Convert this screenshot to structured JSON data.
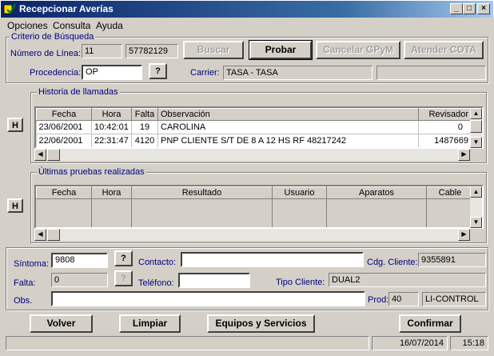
{
  "window": {
    "title": "Recepcionar Averías"
  },
  "menu": [
    "Opciones",
    "Consulta",
    "Ayuda"
  ],
  "criterio": {
    "legend": "Criterio de Búsqueda",
    "linea_label": "Número de Línea:",
    "linea_prefix": "11",
    "linea_number": "57782129",
    "procedencia_label": "Procedencia:",
    "procedencia_value": "OP",
    "help_label": "?",
    "carrier_label": "Carrier:",
    "carrier_value": "TASA - TASA",
    "carrier_extra": ""
  },
  "buttons": {
    "buscar": "Buscar",
    "probar": "Probar",
    "cancelar": "Cancelar GPyM",
    "atender": "Atender COTA"
  },
  "historia": {
    "legend": "Historia de llamadas",
    "h_label": "H",
    "columns": [
      "Fecha",
      "Hora",
      "Falta",
      "Observación",
      "Revisador"
    ],
    "rows": [
      [
        "23/06/2001",
        "10:42:01",
        "19",
        "CAROLINA",
        "0"
      ],
      [
        "22/06/2001",
        "22:31:47",
        "4120",
        "PNP CLIENTE S/T DE 8 A 12 HS RF 48217242",
        "1487669"
      ]
    ]
  },
  "pruebas": {
    "legend": "Últimas pruebas realizadas",
    "h_label": "H",
    "columns": [
      "Fecha",
      "Hora",
      "Resultado",
      "Usuario",
      "Aparatos",
      "Cable"
    ]
  },
  "detalle": {
    "sintoma_label": "Síntoma:",
    "sintoma_value": "9808",
    "sintoma_help": "?",
    "contacto_label": "Contacto:",
    "contacto_value": "",
    "cdg_label": "Cdg. Cliente:",
    "cdg_value": "9355891",
    "falta_label": "Falta:",
    "falta_value": "0",
    "falta_help": "?",
    "telefono_label": "Teléfono:",
    "telefono_value": "",
    "tipo_label": "Tipo Cliente:",
    "tipo_value": "DUAL2",
    "obs_label": "Obs.",
    "obs_value": "",
    "prod_label": "Prod:",
    "prod_code": "40",
    "prod_value": "LI-CONTROL"
  },
  "footer_buttons": {
    "volver": "Volver",
    "limpiar": "Limpiar",
    "equipos": "Equipos y Servicios",
    "confirmar": "Confirmar"
  },
  "status": {
    "message": "",
    "date": "16/07/2014",
    "time": "15:18"
  }
}
